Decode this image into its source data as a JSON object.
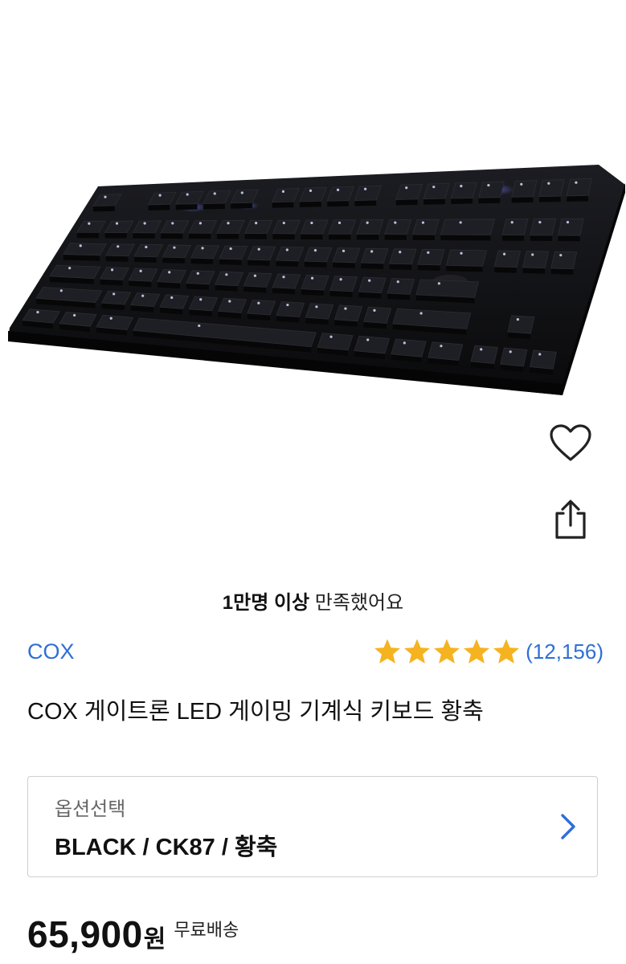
{
  "product_image": {
    "alt": "keyboard"
  },
  "actions": {
    "wishlist_icon": "heart-outline-icon",
    "share_icon": "share-icon"
  },
  "satisfaction": {
    "bold": "1만명 이상",
    "rest": "만족했어요"
  },
  "brand": "COX",
  "rating": {
    "stars": 5,
    "count": "(12,156)",
    "star_color": "#f5b320"
  },
  "title": "COX 게이트론 LED 게이밍 기계식 키보드 황축",
  "option": {
    "label": "옵션선택",
    "value": "BLACK / CK87 / 황축"
  },
  "price": {
    "amount": "65,900",
    "currency": "원",
    "shipping": "무료배송"
  },
  "colors": {
    "accent": "#2f6fd6",
    "text": "#111111"
  }
}
